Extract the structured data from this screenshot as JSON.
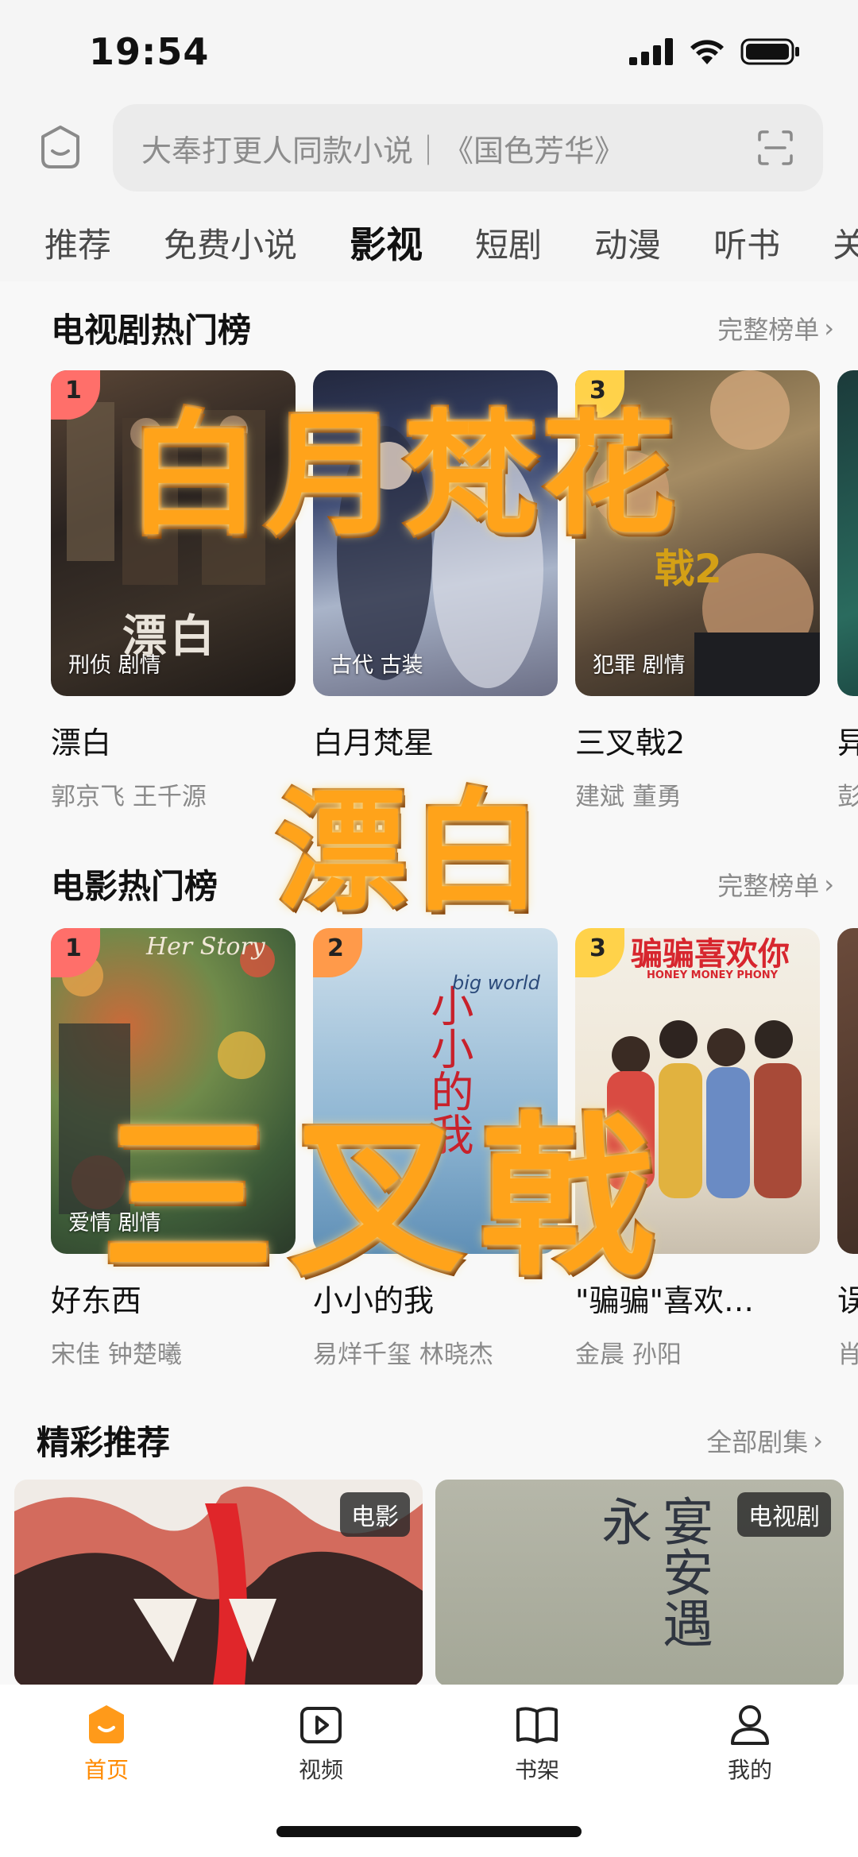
{
  "status": {
    "time": "19:54"
  },
  "search": {
    "placeholder": "大奉打更人同款小说｜《国色芳华》"
  },
  "tabs": [
    "推荐",
    "免费小说",
    "影视",
    "短剧",
    "动漫",
    "听书",
    "关"
  ],
  "tv_section": {
    "title": "电视剧热门榜",
    "more": "完整榜单",
    "items": [
      {
        "rank": "1",
        "tag": "刑侦 剧情",
        "title": "漂白",
        "cast": "郭京飞 王千源"
      },
      {
        "rank": "",
        "tag": "古代 古装",
        "title": "白月梵星",
        "cast": ""
      },
      {
        "rank": "3",
        "tag": "犯罪 剧情",
        "title": "三叉戟2",
        "cast": "建斌 董勇"
      },
      {
        "rank": "",
        "tag": "",
        "title": "异",
        "cast": "彭"
      }
    ]
  },
  "movie_section": {
    "title": "电影热门榜",
    "more": "完整榜单",
    "items": [
      {
        "rank": "1",
        "tag": "爱情 剧情",
        "title": "好东西",
        "cast": "宋佳 钟楚曦"
      },
      {
        "rank": "2",
        "tag": "",
        "title": "小小的我",
        "cast": "易烊千玺 林晓杰"
      },
      {
        "rank": "3",
        "tag": "",
        "title": "\"骗骗\"喜欢…",
        "cast": "金晨 孙阳"
      },
      {
        "rank": "",
        "tag": "",
        "title": "误",
        "cast": "肖"
      }
    ]
  },
  "featured": {
    "title": "精彩推荐",
    "more": "全部剧集",
    "items": [
      {
        "badge": "电影"
      },
      {
        "badge": "电视剧",
        "art_text": "宴安遇永"
      }
    ]
  },
  "overlays": [
    "白月梵花",
    "漂白",
    "三叉戟"
  ],
  "posters": {
    "movie2_text": "小小的我",
    "movie2_en": "big world",
    "movie3_text": "骗骗喜欢你",
    "movie3_en": "HONEY MONEY PHONY",
    "movie1_en": "Her Story",
    "tv1_text": "漂白",
    "tv3_text": "戟2"
  },
  "bottom_nav": [
    {
      "label": "首页",
      "icon": "home-icon",
      "active": true
    },
    {
      "label": "视频",
      "icon": "video-icon",
      "active": false
    },
    {
      "label": "书架",
      "icon": "bookshelf-icon",
      "active": false
    },
    {
      "label": "我的",
      "icon": "profile-icon",
      "active": false
    }
  ],
  "colors": {
    "accent": "#ff8a00",
    "overlay": "#ffa31a"
  }
}
